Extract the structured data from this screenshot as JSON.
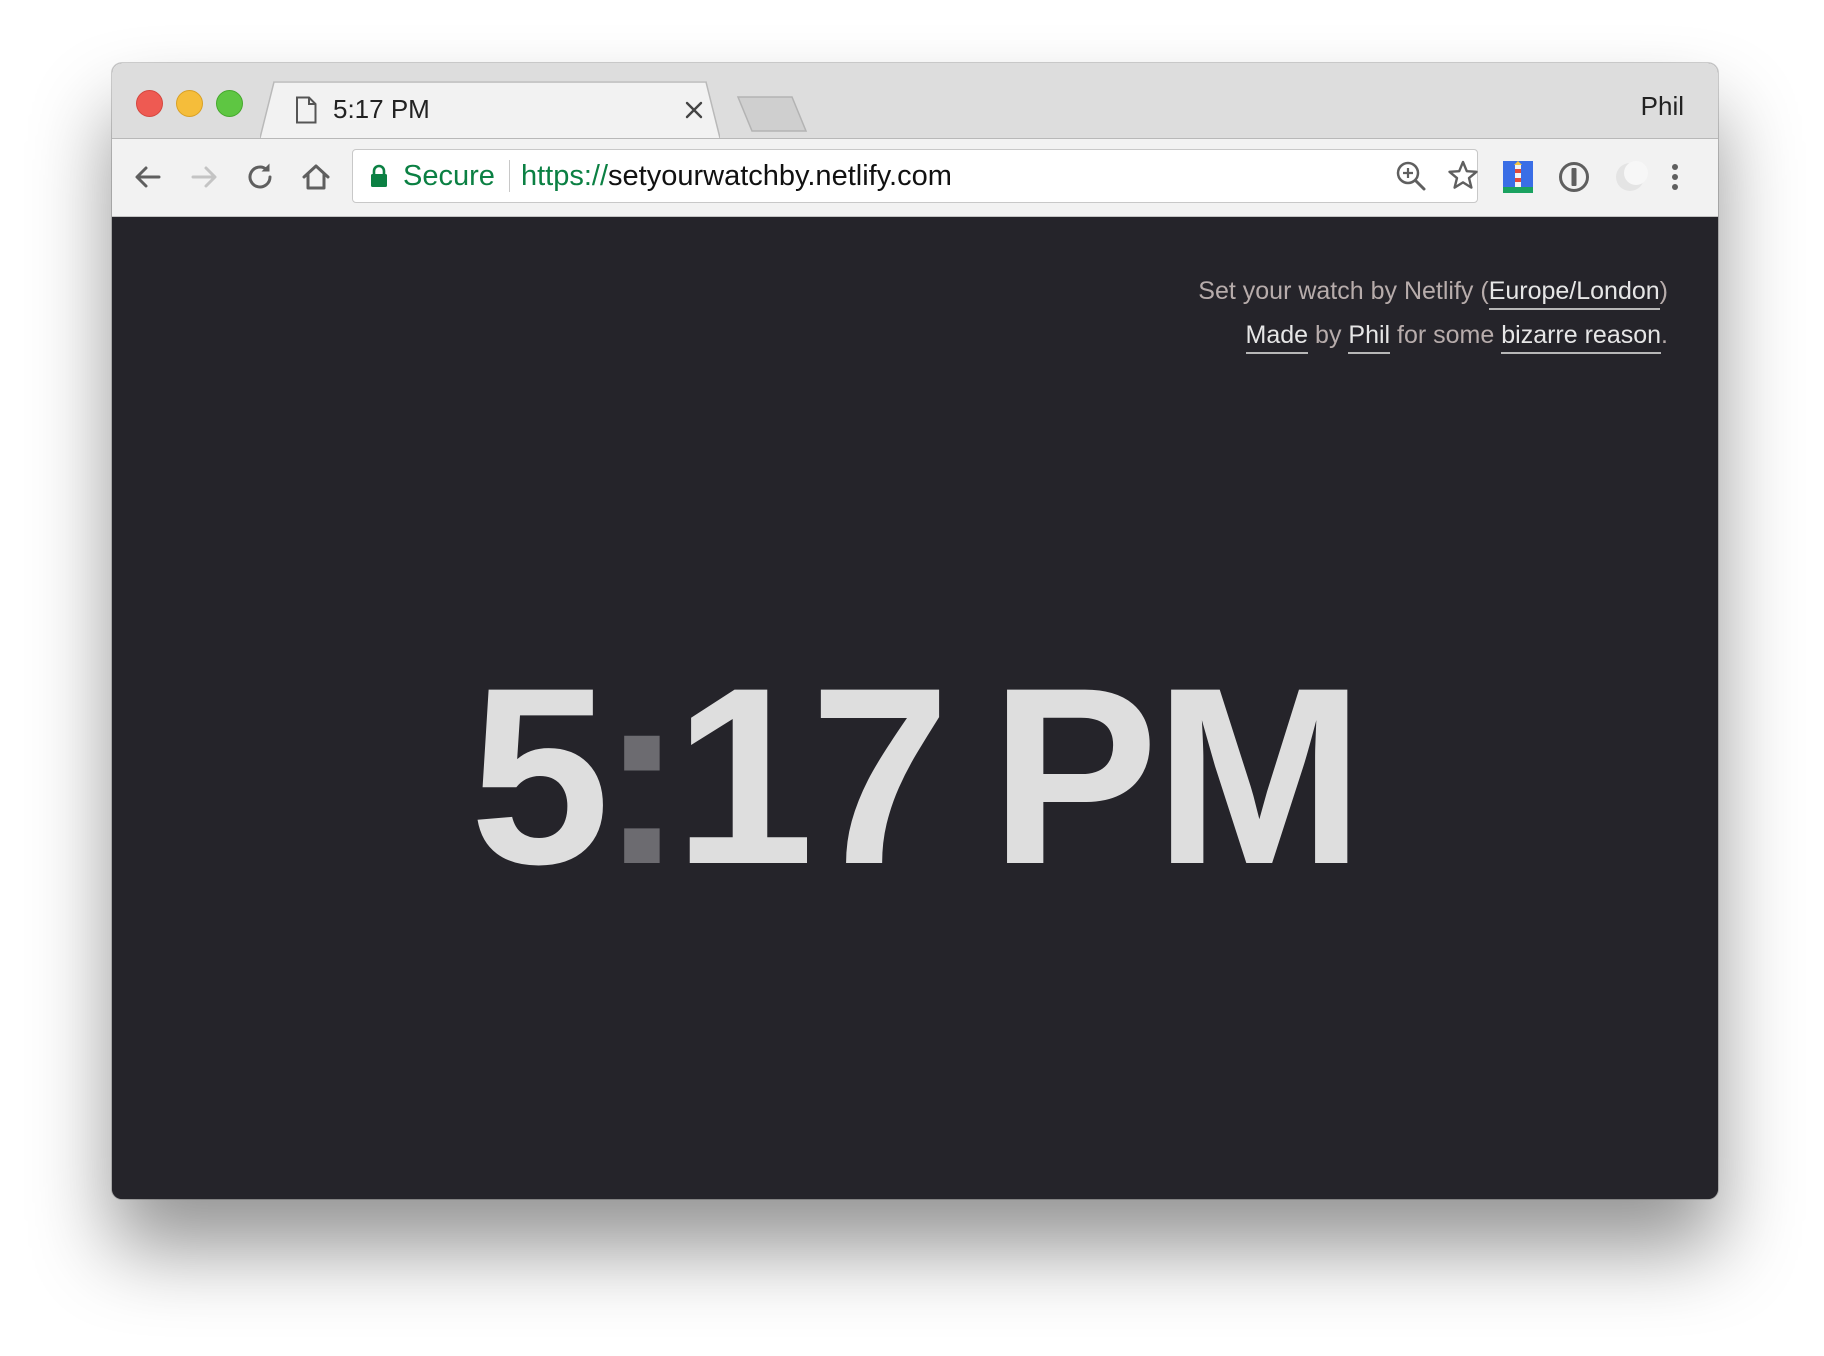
{
  "browser": {
    "tab": {
      "title": "5:17 PM"
    },
    "profile_name": "Phil",
    "omnibox": {
      "security_label": "Secure",
      "url_scheme": "https://",
      "url_host": "setyourwatchby.netlify.com"
    },
    "icons": [
      "page-icon",
      "close-icon",
      "new-tab-icon",
      "back-arrow-icon",
      "forward-arrow-icon",
      "reload-icon",
      "home-icon",
      "lock-icon",
      "zoom-icon",
      "star-icon",
      "lighthouse-extension-icon",
      "1password-extension-icon",
      "moon-extension-icon",
      "menu-kebab-icon"
    ],
    "colors": {
      "close": "#ee5a52",
      "minimize": "#f5bd3a",
      "maximize": "#5ec642",
      "secure_green": "#0b8043"
    }
  },
  "page": {
    "info_line1": {
      "prefix": "Set your watch by Netlify (",
      "timezone_link": "Europe/London",
      "suffix": ")"
    },
    "info_line2": {
      "made_link": "Made",
      "by_text": " by ",
      "author_link": "Phil",
      "for_text": " for some ",
      "reason_link": "bizarre reason",
      "period": "."
    },
    "clock": {
      "hour": "5",
      "separator": ":",
      "minutes": "17",
      "meridiem": "PM"
    },
    "colors": {
      "background": "#25242a",
      "clock_text": "#dedede",
      "colon": "#6c6b70",
      "info_text": "#b7acab",
      "link_text": "#e6e6e6"
    }
  }
}
